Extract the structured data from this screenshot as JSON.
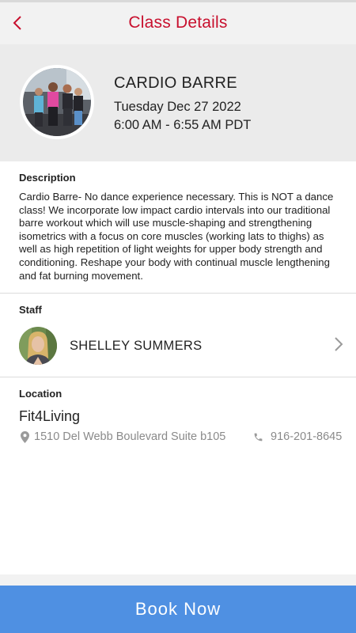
{
  "colors": {
    "brand_red": "#c8102e",
    "book_button_blue": "#4f90e2",
    "muted_text": "#8a8a8a"
  },
  "header": {
    "back_icon": "chevron-left-icon",
    "title": "Class Details"
  },
  "class_info": {
    "name": "CARDIO BARRE",
    "date": "Tuesday Dec 27 2022",
    "time": "6:00 AM - 6:55 AM PDT"
  },
  "description": {
    "label": "Description",
    "text": "Cardio Barre- No dance experience necessary. This is NOT a dance class! We incorporate low impact cardio intervals into our traditional barre workout which will use muscle-shaping and strengthening isometrics with a focus on core muscles (working lats to thighs) as well as high repetition of light weights for upper body strength and conditioning. Reshape your body with continual muscle lengthening and fat burning movement."
  },
  "staff": {
    "label": "Staff",
    "name": "SHELLEY SUMMERS",
    "chevron_icon": "chevron-right-icon"
  },
  "location": {
    "label": "Location",
    "name": "Fit4Living",
    "address": "1510 Del Webb Boulevard Suite b105",
    "address_icon": "map-pin-icon",
    "phone": "916-201-8645",
    "phone_icon": "phone-icon"
  },
  "actions": {
    "book_label": "Book Now"
  }
}
